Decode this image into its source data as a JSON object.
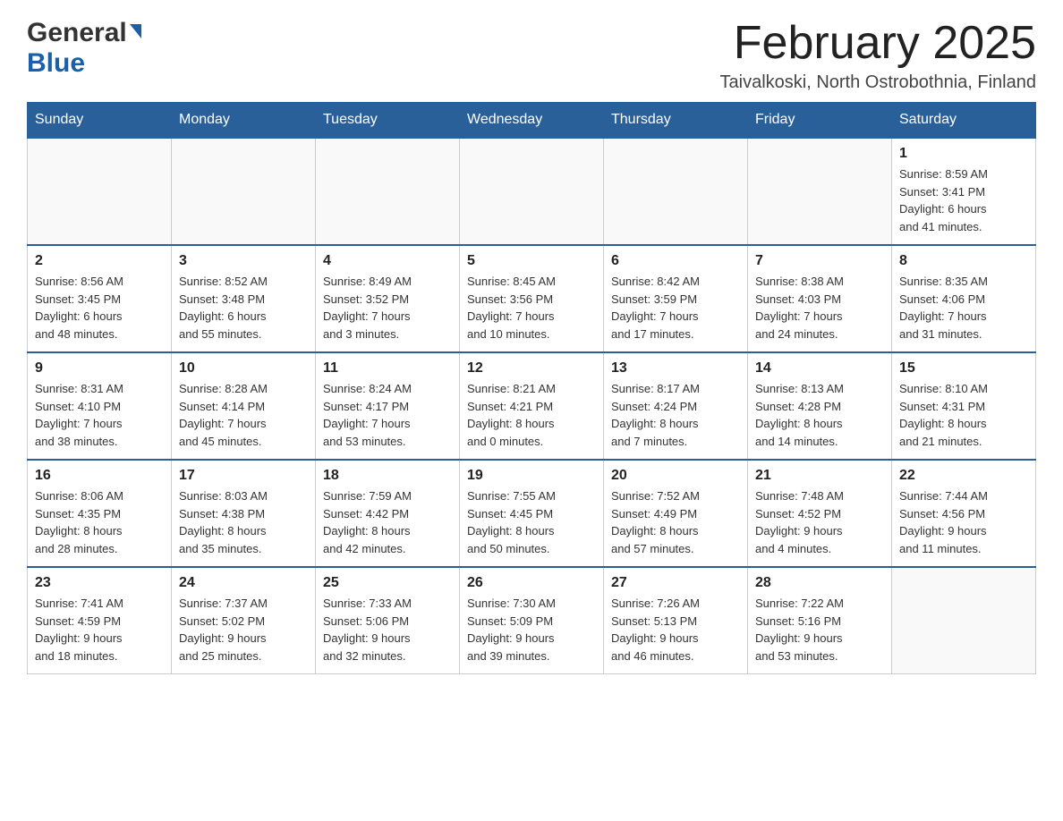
{
  "header": {
    "logo_general": "General",
    "logo_blue": "Blue",
    "month_title": "February 2025",
    "location": "Taivalkoski, North Ostrobothnia, Finland"
  },
  "weekdays": [
    "Sunday",
    "Monday",
    "Tuesday",
    "Wednesday",
    "Thursday",
    "Friday",
    "Saturday"
  ],
  "weeks": [
    [
      {
        "day": "",
        "info": ""
      },
      {
        "day": "",
        "info": ""
      },
      {
        "day": "",
        "info": ""
      },
      {
        "day": "",
        "info": ""
      },
      {
        "day": "",
        "info": ""
      },
      {
        "day": "",
        "info": ""
      },
      {
        "day": "1",
        "info": "Sunrise: 8:59 AM\nSunset: 3:41 PM\nDaylight: 6 hours\nand 41 minutes."
      }
    ],
    [
      {
        "day": "2",
        "info": "Sunrise: 8:56 AM\nSunset: 3:45 PM\nDaylight: 6 hours\nand 48 minutes."
      },
      {
        "day": "3",
        "info": "Sunrise: 8:52 AM\nSunset: 3:48 PM\nDaylight: 6 hours\nand 55 minutes."
      },
      {
        "day": "4",
        "info": "Sunrise: 8:49 AM\nSunset: 3:52 PM\nDaylight: 7 hours\nand 3 minutes."
      },
      {
        "day": "5",
        "info": "Sunrise: 8:45 AM\nSunset: 3:56 PM\nDaylight: 7 hours\nand 10 minutes."
      },
      {
        "day": "6",
        "info": "Sunrise: 8:42 AM\nSunset: 3:59 PM\nDaylight: 7 hours\nand 17 minutes."
      },
      {
        "day": "7",
        "info": "Sunrise: 8:38 AM\nSunset: 4:03 PM\nDaylight: 7 hours\nand 24 minutes."
      },
      {
        "day": "8",
        "info": "Sunrise: 8:35 AM\nSunset: 4:06 PM\nDaylight: 7 hours\nand 31 minutes."
      }
    ],
    [
      {
        "day": "9",
        "info": "Sunrise: 8:31 AM\nSunset: 4:10 PM\nDaylight: 7 hours\nand 38 minutes."
      },
      {
        "day": "10",
        "info": "Sunrise: 8:28 AM\nSunset: 4:14 PM\nDaylight: 7 hours\nand 45 minutes."
      },
      {
        "day": "11",
        "info": "Sunrise: 8:24 AM\nSunset: 4:17 PM\nDaylight: 7 hours\nand 53 minutes."
      },
      {
        "day": "12",
        "info": "Sunrise: 8:21 AM\nSunset: 4:21 PM\nDaylight: 8 hours\nand 0 minutes."
      },
      {
        "day": "13",
        "info": "Sunrise: 8:17 AM\nSunset: 4:24 PM\nDaylight: 8 hours\nand 7 minutes."
      },
      {
        "day": "14",
        "info": "Sunrise: 8:13 AM\nSunset: 4:28 PM\nDaylight: 8 hours\nand 14 minutes."
      },
      {
        "day": "15",
        "info": "Sunrise: 8:10 AM\nSunset: 4:31 PM\nDaylight: 8 hours\nand 21 minutes."
      }
    ],
    [
      {
        "day": "16",
        "info": "Sunrise: 8:06 AM\nSunset: 4:35 PM\nDaylight: 8 hours\nand 28 minutes."
      },
      {
        "day": "17",
        "info": "Sunrise: 8:03 AM\nSunset: 4:38 PM\nDaylight: 8 hours\nand 35 minutes."
      },
      {
        "day": "18",
        "info": "Sunrise: 7:59 AM\nSunset: 4:42 PM\nDaylight: 8 hours\nand 42 minutes."
      },
      {
        "day": "19",
        "info": "Sunrise: 7:55 AM\nSunset: 4:45 PM\nDaylight: 8 hours\nand 50 minutes."
      },
      {
        "day": "20",
        "info": "Sunrise: 7:52 AM\nSunset: 4:49 PM\nDaylight: 8 hours\nand 57 minutes."
      },
      {
        "day": "21",
        "info": "Sunrise: 7:48 AM\nSunset: 4:52 PM\nDaylight: 9 hours\nand 4 minutes."
      },
      {
        "day": "22",
        "info": "Sunrise: 7:44 AM\nSunset: 4:56 PM\nDaylight: 9 hours\nand 11 minutes."
      }
    ],
    [
      {
        "day": "23",
        "info": "Sunrise: 7:41 AM\nSunset: 4:59 PM\nDaylight: 9 hours\nand 18 minutes."
      },
      {
        "day": "24",
        "info": "Sunrise: 7:37 AM\nSunset: 5:02 PM\nDaylight: 9 hours\nand 25 minutes."
      },
      {
        "day": "25",
        "info": "Sunrise: 7:33 AM\nSunset: 5:06 PM\nDaylight: 9 hours\nand 32 minutes."
      },
      {
        "day": "26",
        "info": "Sunrise: 7:30 AM\nSunset: 5:09 PM\nDaylight: 9 hours\nand 39 minutes."
      },
      {
        "day": "27",
        "info": "Sunrise: 7:26 AM\nSunset: 5:13 PM\nDaylight: 9 hours\nand 46 minutes."
      },
      {
        "day": "28",
        "info": "Sunrise: 7:22 AM\nSunset: 5:16 PM\nDaylight: 9 hours\nand 53 minutes."
      },
      {
        "day": "",
        "info": ""
      }
    ]
  ]
}
